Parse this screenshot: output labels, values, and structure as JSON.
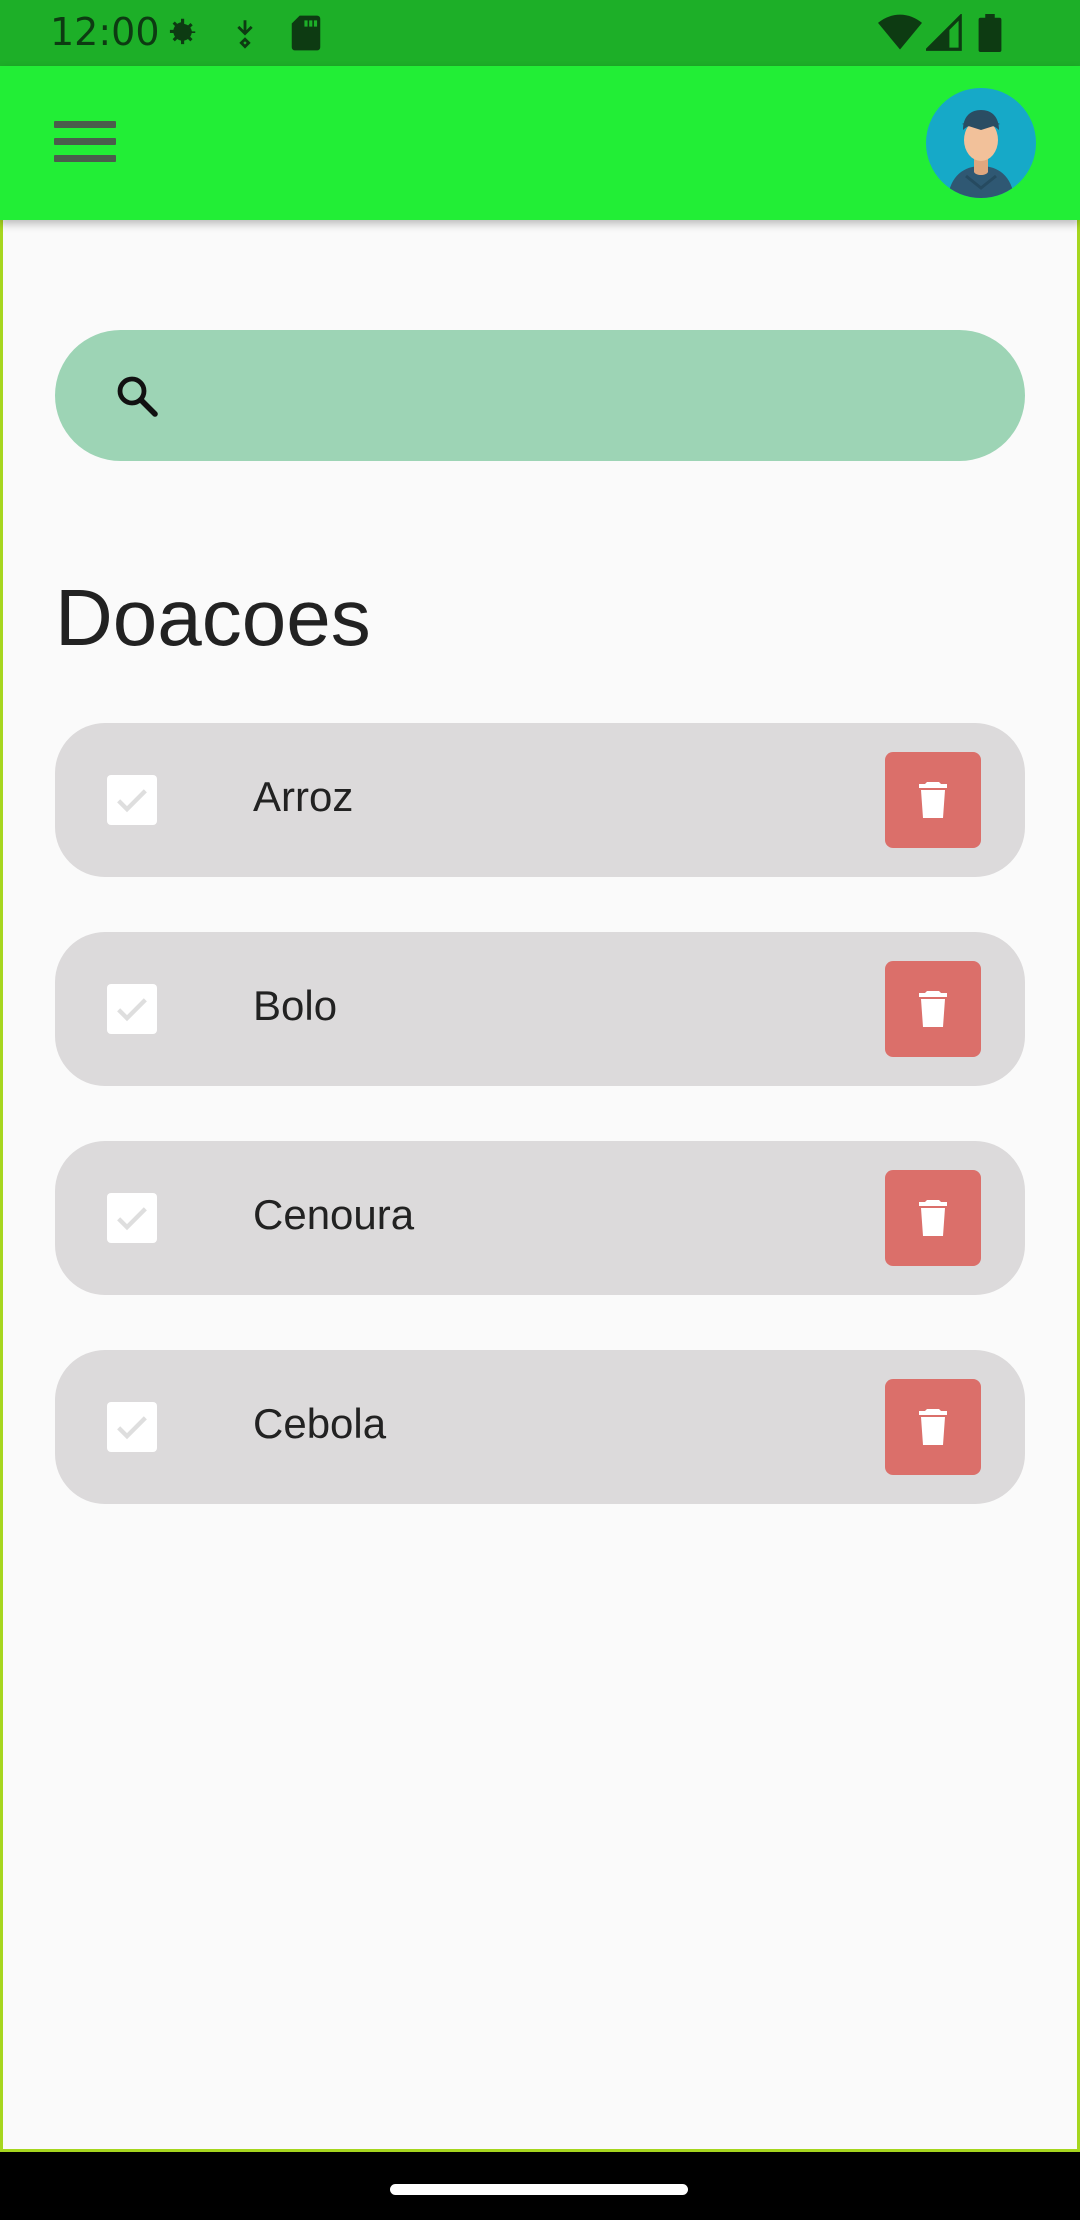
{
  "status_bar": {
    "time": "12:00",
    "icons_left": [
      "settings-icon",
      "download-icon",
      "sd-card-icon"
    ],
    "icons_right": [
      "wifi-icon",
      "signal-icon",
      "battery-icon"
    ]
  },
  "app_bar": {
    "background": "#22ee36",
    "menu_icon": "menu-icon",
    "avatar_icon": "user-avatar-icon"
  },
  "search": {
    "placeholder": "",
    "value": "",
    "background": "#9dd4b5"
  },
  "page": {
    "title": "Doacoes"
  },
  "items": [
    {
      "label": "Arroz",
      "checked": false
    },
    {
      "label": "Bolo",
      "checked": false
    },
    {
      "label": "Cenoura",
      "checked": false
    },
    {
      "label": "Cebola",
      "checked": false
    }
  ],
  "colors": {
    "status_bar": "#1daf28",
    "delete": "#db6f6a",
    "item_bg": "#dcdadb"
  }
}
